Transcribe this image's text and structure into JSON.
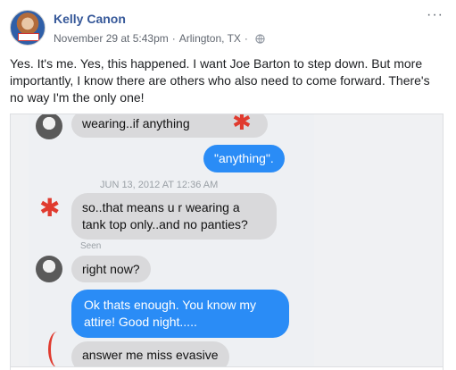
{
  "post": {
    "author": "Kelly Canon",
    "date": "November 29 at 5:43pm",
    "separator": "·",
    "location": "Arlington, TX",
    "more_label": "···",
    "text": "Yes. It's me. Yes, this happened. I want Joe Barton to step down. But more importantly, I know there are others who also need to come forward. There's no way I'm the only one!"
  },
  "conversation": {
    "messages": [
      {
        "side": "received",
        "text": "wearing..if anything"
      },
      {
        "side": "sent",
        "text": "\"anything\"."
      },
      {
        "side": "received",
        "text": "so..that means u r wearing a tank top only..and no panties?"
      },
      {
        "side": "received",
        "text": "right now?"
      },
      {
        "side": "sent",
        "text": "Ok thats enough.  You know my attire!  Good night....."
      },
      {
        "side": "received",
        "text": "answer me miss evasive"
      }
    ],
    "timestamp": "JUN 13, 2012 AT 12:36 AM",
    "seen_label": "Seen"
  },
  "colors": {
    "link": "#365899",
    "sent_bubble": "#2a8cf6",
    "received_bubble": "#d9d9db",
    "annotation": "#e03b2f"
  },
  "icons": {
    "globe": "globe-icon",
    "more": "more-icon",
    "annotation_star": "star-icon"
  }
}
